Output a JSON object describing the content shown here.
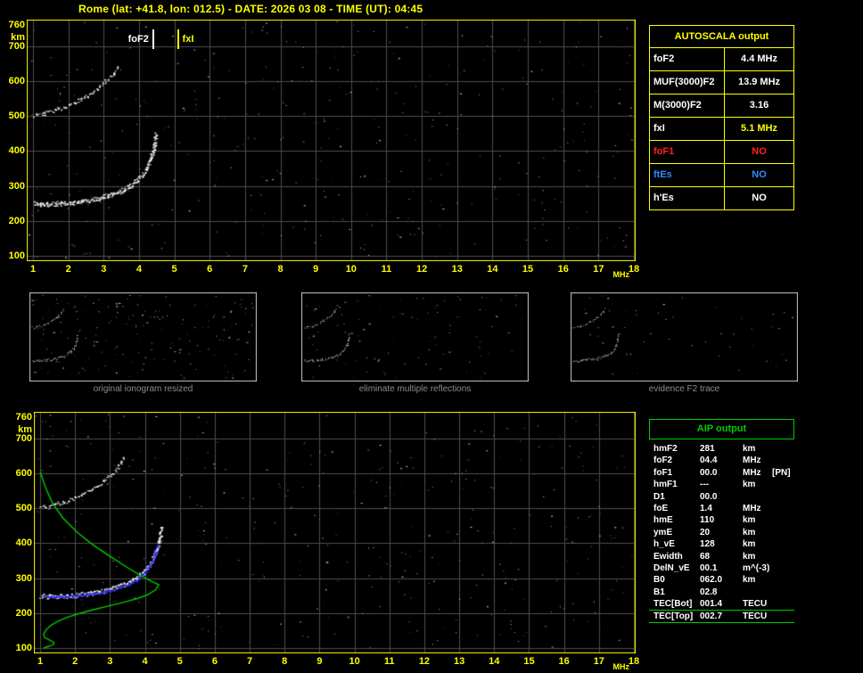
{
  "title": "Rome (lat: +41.8, lon: 012.5) - DATE: 2026 03 08 - TIME (UT): 04:45",
  "colors": {
    "accent_yellow": "#ffff00",
    "accent_green": "#00cc00",
    "grid": "#4d4d4d",
    "trace_white": "#ffffff",
    "trace_blue": "#2a2aff",
    "profile_green": "#00c800",
    "no_red": "#ff2020",
    "es_blue": "#2e8bff",
    "caption_gray": "#8c8c8c"
  },
  "autoscala_table": {
    "header": "AUTOSCALA output",
    "rows": [
      {
        "label": "foF2",
        "value": "4.4 MHz",
        "label_color": "#ffffff",
        "value_color": "#ffffff"
      },
      {
        "label": "MUF(3000)F2",
        "value": "13.9 MHz",
        "label_color": "#ffffff",
        "value_color": "#ffffff"
      },
      {
        "label": "M(3000)F2",
        "value": "3.16",
        "label_color": "#ffffff",
        "value_color": "#ffffff"
      },
      {
        "label": "fxI",
        "value": "5.1 MHz",
        "label_color": "#ffffff",
        "value_color": "#ffff00"
      },
      {
        "label": "foF1",
        "value": "NO",
        "label_color": "#ff2020",
        "value_color": "#ff2020"
      },
      {
        "label": "ftEs",
        "value": "NO",
        "label_color": "#2e8bff",
        "value_color": "#2e8bff"
      },
      {
        "label": "h'Es",
        "value": "NO",
        "label_color": "#ffffff",
        "value_color": "#ffffff"
      }
    ]
  },
  "panels": [
    {
      "caption": "original ionogram resized"
    },
    {
      "caption": "eliminate multiple reflections"
    },
    {
      "caption": "evidence F2 trace"
    }
  ],
  "aip_table": {
    "header": "AIP output",
    "rows": [
      {
        "name": "hmF2",
        "value": "281",
        "unit": "km",
        "extra": ""
      },
      {
        "name": "foF2",
        "value": "04.4",
        "unit": "MHz",
        "extra": ""
      },
      {
        "name": "foF1",
        "value": "00.0",
        "unit": "MHz",
        "extra": "[PN]"
      },
      {
        "name": "hmF1",
        "value": "---",
        "unit": "km",
        "extra": ""
      },
      {
        "name": "D1",
        "value": "00.0",
        "unit": "",
        "extra": ""
      },
      {
        "name": "foE",
        "value": "1.4",
        "unit": "MHz",
        "extra": ""
      },
      {
        "name": "hmE",
        "value": "110",
        "unit": "km",
        "extra": ""
      },
      {
        "name": "ymE",
        "value": "20",
        "unit": "km",
        "extra": ""
      },
      {
        "name": "h_vE",
        "value": "128",
        "unit": "km",
        "extra": ""
      },
      {
        "name": "Ewidth",
        "value": "68",
        "unit": "km",
        "extra": ""
      },
      {
        "name": "DelN_vE",
        "value": "00.1",
        "unit": "m^(-3)",
        "extra": ""
      },
      {
        "name": "B0",
        "value": "062.0",
        "unit": "km",
        "extra": ""
      },
      {
        "name": "B1",
        "value": "02.8",
        "unit": "",
        "extra": ""
      },
      {
        "name": "TEC[Bot]",
        "value": "001.4",
        "unit": "TECU",
        "extra": "",
        "separator": true
      },
      {
        "name": "TEC[Top]",
        "value": "002.7",
        "unit": "TECU",
        "extra": "",
        "separator": true
      }
    ]
  },
  "chart_data": [
    {
      "id": "main_ionogram",
      "type": "scatter",
      "title": "scaled ionogram with AUTOSCALA markers",
      "xlabel": "MHz",
      "ylabel": "km",
      "x_unit": "MHz",
      "y_unit": "km",
      "xlim": [
        1,
        18
      ],
      "ylim": [
        100,
        760
      ],
      "xticks": [
        1,
        2,
        3,
        4,
        5,
        6,
        7,
        8,
        9,
        10,
        11,
        12,
        13,
        14,
        15,
        16,
        17,
        18
      ],
      "yticks": [
        760,
        700,
        600,
        500,
        400,
        300,
        200,
        100
      ],
      "grid": true,
      "markers": [
        {
          "name": "foF2",
          "x": 4.4,
          "color": "#ffffff"
        },
        {
          "name": "fxI",
          "x": 5.1,
          "color": "#ffff00"
        }
      ],
      "series": [
        {
          "name": "F2 trace first hop",
          "color": "#ffffff",
          "style": "trace",
          "density": 1.3,
          "jitter": 2.5,
          "points": [
            [
              1.0,
              250
            ],
            [
              1.3,
              248
            ],
            [
              1.6,
              249
            ],
            [
              2.0,
              252
            ],
            [
              2.4,
              257
            ],
            [
              2.8,
              264
            ],
            [
              3.1,
              272
            ],
            [
              3.4,
              283
            ],
            [
              3.7,
              298
            ],
            [
              3.95,
              318
            ],
            [
              4.15,
              342
            ],
            [
              4.3,
              372
            ],
            [
              4.4,
              408
            ],
            [
              4.47,
              450
            ]
          ]
        },
        {
          "name": "F2 trace second hop",
          "color": "#ffffff",
          "style": "trace",
          "density": 0.55,
          "jitter": 2,
          "points": [
            [
              1.0,
              503
            ],
            [
              1.3,
              508
            ],
            [
              1.6,
              516
            ],
            [
              1.9,
              527
            ],
            [
              2.2,
              541
            ],
            [
              2.5,
              558
            ],
            [
              2.8,
              578
            ],
            [
              3.05,
              600
            ],
            [
              3.25,
              622
            ],
            [
              3.4,
              645
            ]
          ]
        }
      ]
    },
    {
      "id": "profile_ionogram",
      "type": "scatter",
      "title": "ionogram with restored trace and electron density profile",
      "xlabel": "MHz",
      "ylabel": "km",
      "x_unit": "MHz",
      "y_unit": "km",
      "xlim": [
        1,
        18
      ],
      "ylim": [
        100,
        760
      ],
      "xticks": [
        1,
        2,
        3,
        4,
        5,
        6,
        7,
        8,
        9,
        10,
        11,
        12,
        13,
        14,
        15,
        16,
        17,
        18
      ],
      "yticks": [
        760,
        700,
        600,
        500,
        400,
        300,
        200,
        100
      ],
      "grid": true,
      "markers": [],
      "series": [
        {
          "name": "F2 trace first hop",
          "color": "#ffffff",
          "style": "trace",
          "density": 1.3,
          "jitter": 2.5,
          "points": [
            [
              1.0,
              250
            ],
            [
              1.3,
              248
            ],
            [
              1.6,
              249
            ],
            [
              2.0,
              252
            ],
            [
              2.4,
              257
            ],
            [
              2.8,
              264
            ],
            [
              3.1,
              272
            ],
            [
              3.4,
              283
            ],
            [
              3.7,
              298
            ],
            [
              3.95,
              318
            ],
            [
              4.15,
              342
            ],
            [
              4.3,
              372
            ],
            [
              4.4,
              408
            ],
            [
              4.47,
              450
            ]
          ]
        },
        {
          "name": "F2 trace second hop",
          "color": "#ffffff",
          "style": "trace",
          "density": 0.55,
          "jitter": 2,
          "points": [
            [
              1.0,
              503
            ],
            [
              1.3,
              508
            ],
            [
              1.6,
              516
            ],
            [
              1.9,
              527
            ],
            [
              2.2,
              541
            ],
            [
              2.5,
              558
            ],
            [
              2.8,
              578
            ],
            [
              3.05,
              600
            ],
            [
              3.25,
              622
            ],
            [
              3.4,
              645
            ]
          ]
        },
        {
          "name": "restored trace points",
          "color": "#2a2aff",
          "style": "trace",
          "density": 0.9,
          "jitter": 1.2,
          "points": [
            [
              1.1,
              247
            ],
            [
              1.5,
              247
            ],
            [
              2.0,
              250
            ],
            [
              2.5,
              256
            ],
            [
              2.9,
              263
            ],
            [
              3.25,
              273
            ],
            [
              3.55,
              285
            ],
            [
              3.8,
              300
            ],
            [
              4.0,
              318
            ],
            [
              4.15,
              340
            ],
            [
              4.27,
              365
            ],
            [
              4.35,
              395
            ]
          ]
        },
        {
          "name": "electron density profile",
          "color": "#00c800",
          "style": "line",
          "points": [
            [
              1.0,
              605
            ],
            [
              1.15,
              560
            ],
            [
              1.35,
              515
            ],
            [
              1.65,
              472
            ],
            [
              2.05,
              432
            ],
            [
              2.5,
              396
            ],
            [
              3.0,
              362
            ],
            [
              3.5,
              330
            ],
            [
              3.9,
              306
            ],
            [
              4.2,
              290
            ],
            [
              4.38,
              282
            ],
            [
              4.4,
              281
            ],
            [
              4.3,
              266
            ],
            [
              4.1,
              253
            ],
            [
              3.8,
              242
            ],
            [
              3.4,
              231
            ],
            [
              2.95,
              220
            ],
            [
              2.5,
              209
            ],
            [
              2.1,
              198
            ],
            [
              1.75,
              187
            ],
            [
              1.5,
              176
            ],
            [
              1.3,
              164
            ],
            [
              1.17,
              152
            ],
            [
              1.1,
              140
            ],
            [
              1.12,
              131
            ],
            [
              1.25,
              124
            ],
            [
              1.4,
              116
            ],
            [
              1.38,
              110
            ],
            [
              1.25,
              105
            ],
            [
              1.1,
              100
            ]
          ]
        }
      ]
    }
  ]
}
